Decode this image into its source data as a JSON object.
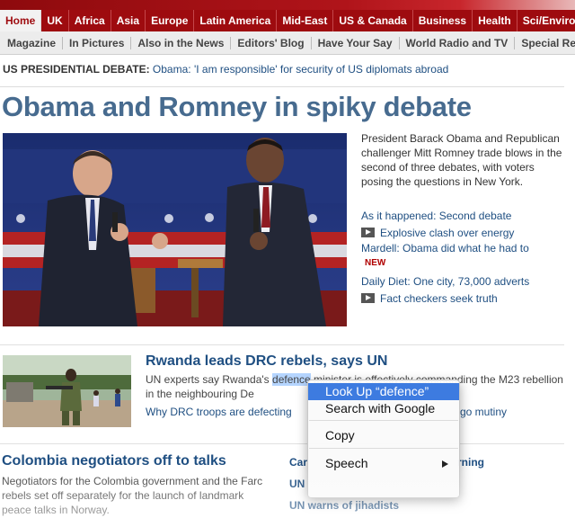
{
  "nav": {
    "primary": [
      "Home",
      "UK",
      "Africa",
      "Asia",
      "Europe",
      "Latin America",
      "Mid-East",
      "US & Canada",
      "Business",
      "Health",
      "Sci/Environ"
    ],
    "secondary": [
      "Magazine",
      "In Pictures",
      "Also in the News",
      "Editors' Blog",
      "Have Your Say",
      "World Radio and TV",
      "Special Re"
    ]
  },
  "breaking": {
    "label": "US PRESIDENTIAL DEBATE:",
    "link": "Obama: 'I am responsible' for security of US diplomats abroad"
  },
  "lead": {
    "headline": "Obama and Romney in spiky debate",
    "summary": "President Barack Obama and Republican challenger Mitt Romney trade blows in the second of three debates, with voters posing the questions in New York.",
    "links": [
      {
        "text": "As it happened: Second debate",
        "video": false
      },
      {
        "text": "Explosive clash over energy",
        "video": true
      },
      {
        "text": "Mardell: Obama did what he had to",
        "video": false
      },
      {
        "text": "Daily Diet: One city, 73,000 adverts",
        "video": false
      },
      {
        "text": "Fact checkers seek truth",
        "video": true
      }
    ],
    "new_tag": "NEW"
  },
  "rwanda": {
    "headline": "Rwanda leads DRC rebels, says UN",
    "text_before": "UN experts say Rwanda's ",
    "text_selected": "defence",
    "text_after": " minister is effectively commanding the M23 rebellion in the neighbouring De",
    "link_left": "Why DRC troops are defecting",
    "link_right": "go mutiny"
  },
  "colombia": {
    "headline": "Colombia negotiators off to talks",
    "summary": "Negotiators for the Colombia government and the Farc rebels set off separately for the launch of landmark peace talks in Norway."
  },
  "right_column": {
    "item1_left": "Car",
    "item1_right": "rning",
    "item2": "UN",
    "item3": "UN warns of jihadists"
  },
  "context_menu": {
    "items": [
      "Look Up “defence”",
      "Search with Google",
      "Copy",
      "Speech"
    ]
  }
}
